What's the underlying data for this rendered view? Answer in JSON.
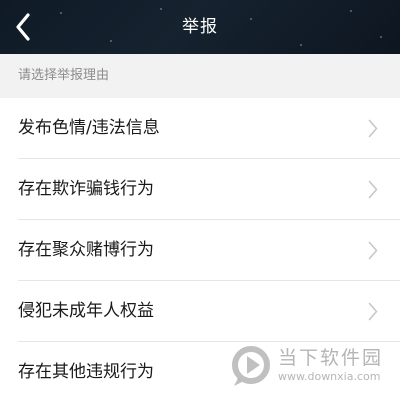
{
  "navbar": {
    "title": "举报",
    "back_icon": "chevron-left-icon"
  },
  "section": {
    "header": "请选择举报理由"
  },
  "reasons": [
    {
      "label": "发布色情/违法信息"
    },
    {
      "label": "存在欺诈骗钱行为"
    },
    {
      "label": "存在聚众赌博行为"
    },
    {
      "label": "侵犯未成年人权益"
    },
    {
      "label": "存在其他违规行为"
    }
  ],
  "watermark": {
    "title": "当下软件园",
    "url": "www.downxia.com"
  },
  "colors": {
    "navbar_bg": "#121d29",
    "title_text": "#ffffff",
    "section_bg": "#f2f2f2",
    "section_text": "#8c8c8c",
    "item_text": "#1a1a1a",
    "divider": "#e6e6e6",
    "chevron": "#c7c7cc"
  }
}
